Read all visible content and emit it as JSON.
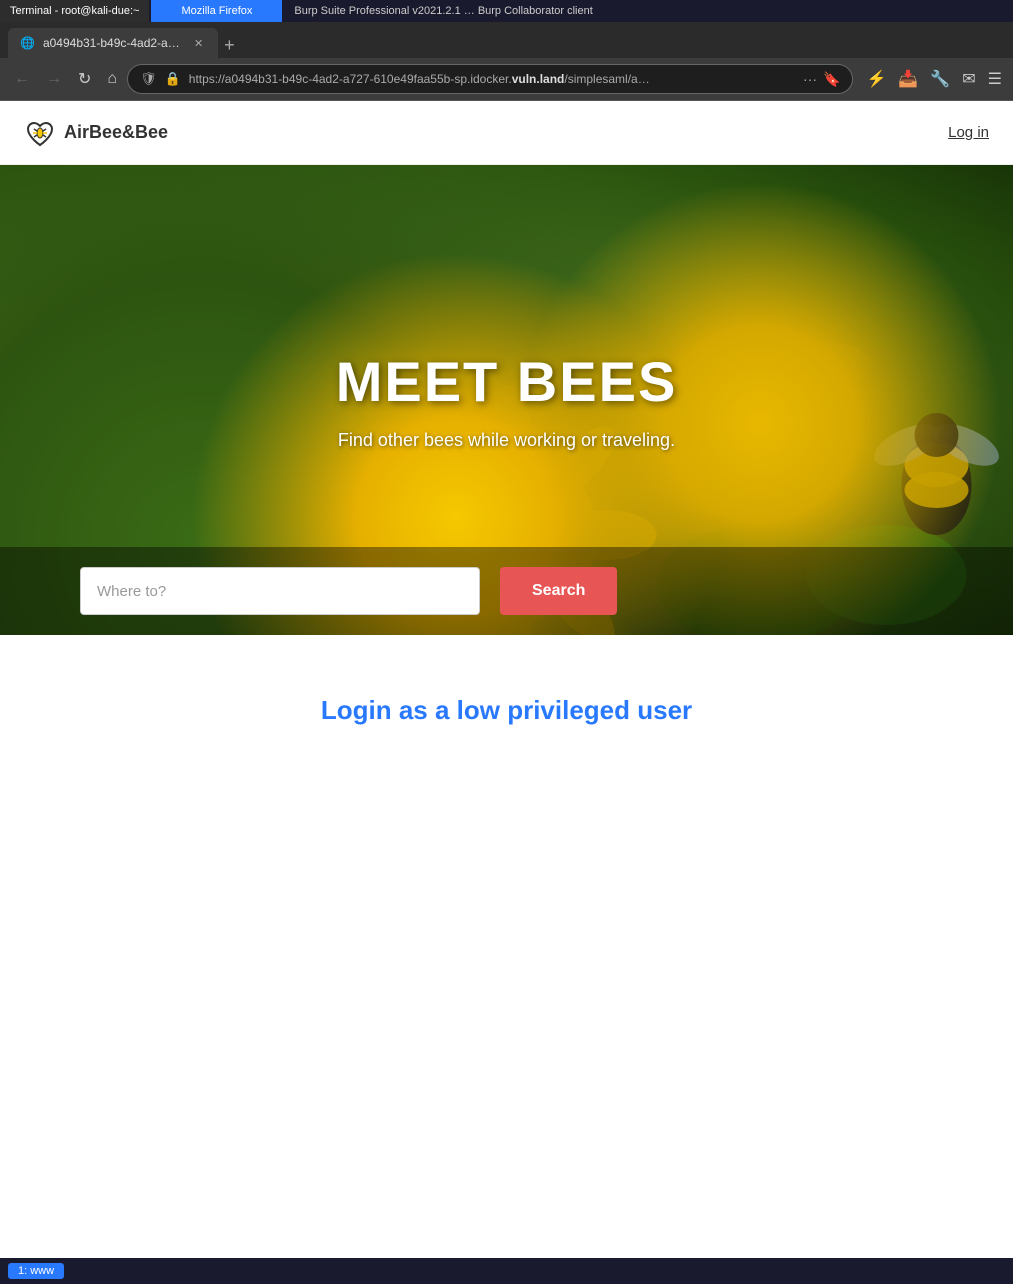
{
  "os_taskbar": {
    "terminal_label": "Terminal - root@kali-due:~",
    "firefox_label": "Mozilla Firefox",
    "burp_label": "Burp Suite Professional v2021.2.1 … Burp Collaborator client"
  },
  "browser": {
    "tab_title": "a0494b31-b49c-4ad2-a727",
    "url_full": "https://a0494b31-b49c-4ad2-a727-610e49faa55b-sp.idocker.vuln.land/simplesaml/a…",
    "url_display_pre": "https://a0494b31-b49c-4ad2-a727-610e49faa55b-sp.idocker.",
    "url_display_bold": "vuln.land",
    "url_display_post": "/simplesaml/a…"
  },
  "site": {
    "logo_text": "AirBee&Bee",
    "login_label": "Log in",
    "hero_title": "MEET BEES",
    "hero_subtitle": "Find other bees while working or traveling.",
    "search_placeholder": "Where to?",
    "search_button_label": "Search",
    "low_priv_label": "Login as a low privileged user"
  },
  "bottom_taskbar": {
    "item_label": "1: www"
  }
}
